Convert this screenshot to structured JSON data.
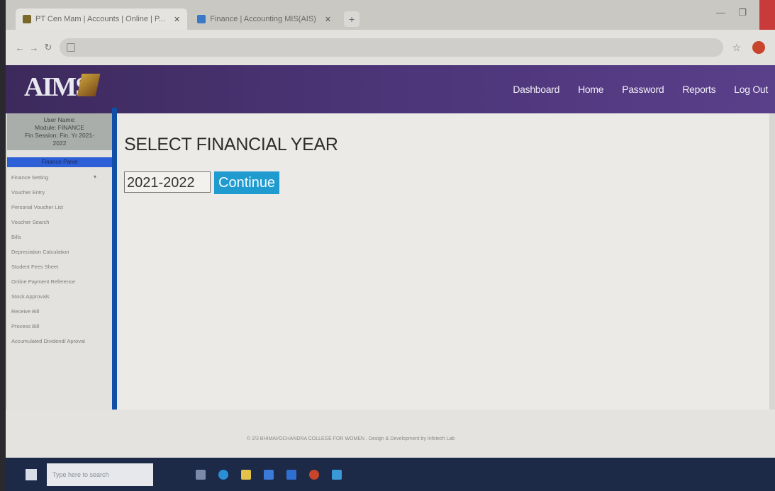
{
  "browser": {
    "tabs": [
      {
        "label": "PT Cen Mam | Accounts | Online | P...",
        "active": true
      },
      {
        "label": "Finance | Accounting MIS(AIS)",
        "active": false
      }
    ],
    "new_tab": "+",
    "url": "",
    "nav": {
      "back": "←",
      "forward": "→",
      "reload": "↻"
    },
    "star": "☆"
  },
  "header": {
    "logo_text": "AIMS",
    "nav": [
      "Dashboard",
      "Home",
      "Password",
      "Reports",
      "Log Out"
    ]
  },
  "sidebar": {
    "user_lines": [
      "User Name:",
      "Module: FINANCE",
      "Fin Session: Fin. Yr 2021-",
      "2022"
    ],
    "panel_title": "Finance Panel",
    "menu": [
      "Finance Setting",
      "Voucher Entry",
      "Personal Voucher List",
      "Voucher Search",
      "Bills",
      "Depreciation Calculation",
      "Student Fees Sheet",
      "Online Payment Reference",
      "Stock Approvals",
      "Receive Bill",
      "Process Bill",
      "Accumulated Dividend/ Aproval"
    ]
  },
  "main": {
    "title": "SELECT FINANCIAL YEAR",
    "financial_year": "2021-2022",
    "continue_label": "Continue"
  },
  "footer": {
    "text": "© 2/3 BHIMAVOCHANDRA COLLEGE FOR WOMEN . Design & Development by Infotech Lab"
  },
  "taskbar": {
    "search_placeholder": "Type here to search"
  },
  "colors": {
    "header_purple": "#4b3476",
    "sidebar_accent": "#0f4fa8",
    "button_blue": "#1f9bd0",
    "taskbar": "#1c2a48"
  }
}
